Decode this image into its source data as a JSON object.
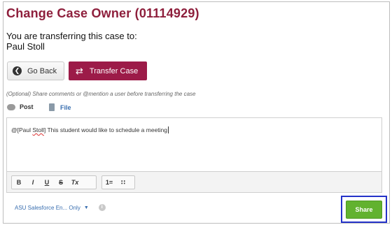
{
  "dialog": {
    "title": "Change Case Owner (01114929)",
    "transfer_message": "You are transferring this case to:",
    "new_owner": "Paul Stoll"
  },
  "actions": {
    "go_back_label": "Go Back",
    "transfer_label": "Transfer Case"
  },
  "composer": {
    "hint": "(Optional) Share comments or @mention a user before transferring the case",
    "tabs": [
      {
        "label": "Post"
      },
      {
        "label": "File"
      }
    ],
    "text_prefix": "@[",
    "mention_first": "Paul ",
    "mention_last": "Stoll",
    "text_rest": "] This student would like to schedule a meeting",
    "formatting": [
      "B",
      "I",
      "U",
      "S",
      "Tx"
    ],
    "lists": [
      "1=",
      "∷"
    ]
  },
  "footer": {
    "visibility_label": "ASU Salesforce En... Only",
    "share_label": "Share"
  },
  "colors": {
    "title": "#8e1f3c",
    "transfer_button": "#9c1b48",
    "share_button": "#62b22f",
    "highlight": "#2432c8",
    "link": "#3a6fb0"
  },
  "icons": {
    "go_back": "back-arrow-circle-icon",
    "transfer": "transfer-arrows-icon",
    "post": "chat-bubble-icon",
    "file": "document-icon",
    "visibility": "chevron-down-icon",
    "help": "info-icon"
  }
}
